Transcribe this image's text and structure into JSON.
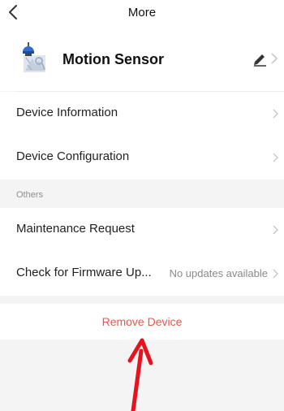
{
  "header": {
    "title": "More",
    "back_icon": "chevron-left-icon"
  },
  "device": {
    "name": "Motion Sensor",
    "thumbnail_icon": "motion-sensor-icon",
    "edit_icon": "pencil-icon",
    "chevron_icon": "chevron-right-icon"
  },
  "rows_top": [
    {
      "label": "Device Information"
    },
    {
      "label": "Device Configuration"
    }
  ],
  "others_section": {
    "title": "Others",
    "rows": [
      {
        "label": "Maintenance Request"
      },
      {
        "label": "Check for Firmware Up...",
        "value": "No updates available"
      }
    ]
  },
  "remove_button_label": "Remove Device",
  "colors": {
    "danger": "#e8574b",
    "background": "#f4f4f4",
    "annotation_arrow": "#e8121c"
  }
}
